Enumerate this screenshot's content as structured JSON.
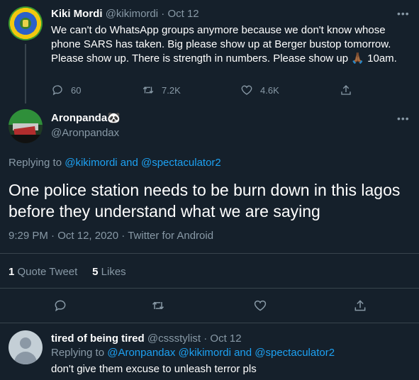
{
  "tweet1": {
    "name": "Kiki Mordi",
    "handle": "@kikimordi",
    "sep": "·",
    "date": "Oct 12",
    "text": "We can't do WhatsApp groups anymore because we don't know whose phone SARS has taken. Big please show up at Berger bustop tomorrow. Please show up. There is strength in numbers. Please show up 🙏🏾 10am.",
    "replies": "60",
    "retweets": "7.2K",
    "likes": "4.6K"
  },
  "main": {
    "name": "Aronpanda",
    "emoji": "🐼",
    "handle": "@Aronpandax",
    "replying_prefix": "Replying to",
    "replying_to": "@kikimordi and @spectaculator2",
    "text": "One police station needs to be burn down  in this lagos before they understand what we are saying",
    "time": "9:29 PM",
    "date": "Oct 12, 2020",
    "source": "Twitter for Android",
    "quote_count": "1",
    "quote_label": "Quote Tweet",
    "like_count": "5",
    "like_label": "Likes"
  },
  "reply": {
    "name": "tired of being tired",
    "handle": "@cssstylist",
    "sep": "·",
    "date": "Oct 12",
    "replying_prefix": "Replying to",
    "replying_to": "@Aronpandax @kikimordi and @spectaculator2",
    "text": "don't give them excuse to unleash terror pls"
  },
  "icons": [
    "more-icon",
    "reply-icon",
    "retweet-icon",
    "like-icon",
    "share-icon"
  ],
  "colors": {
    "background": "#15202b",
    "accent": "#1da1f2",
    "muted": "#8899a6",
    "divider": "#38444d"
  }
}
